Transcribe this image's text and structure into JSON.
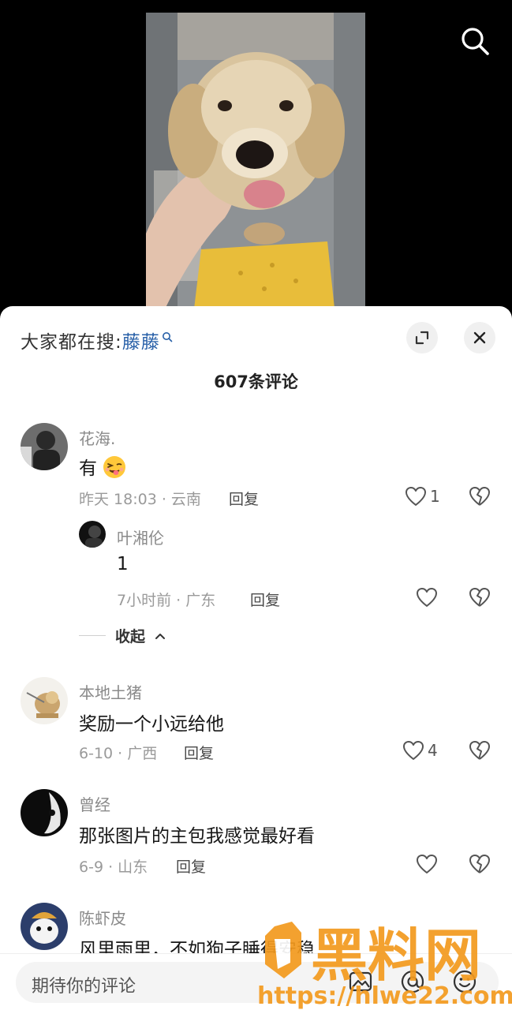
{
  "panel": {
    "hot_search_prefix": "大家都在搜:",
    "hot_search_keyword": "藤藤",
    "comment_count": "607条评论"
  },
  "comments": [
    {
      "username": "花海.",
      "text": "有",
      "emoji": "wink-tongue-emoji",
      "time_location": "昨天 18:03 · 云南",
      "reply_label": "回复",
      "likes": "1",
      "replies": [
        {
          "username": "叶湘伦",
          "text": "1",
          "time_location": "7小时前 · 广东",
          "reply_label": "回复",
          "likes": ""
        }
      ],
      "collapse_label": "收起"
    },
    {
      "username": "本地土猪",
      "text": "奖励一个小远给他",
      "time_location": "6-10 · 广西",
      "reply_label": "回复",
      "likes": "4"
    },
    {
      "username": "曾经",
      "text": "那张图片的主包我感觉最好看",
      "time_location": "6-9 · 山东",
      "reply_label": "回复",
      "likes": ""
    },
    {
      "username": "陈虾皮",
      "text": "风里雨里，不如狗子睡得安稳"
    }
  ],
  "bottom_bar": {
    "placeholder": "期待你的评论",
    "icons": [
      "image-icon",
      "at-icon",
      "emoji-icon"
    ]
  },
  "watermark": {
    "title": "黑料网",
    "url": "https://hlwe22.com"
  },
  "icons": {
    "top_right": "search-icon",
    "panel_buttons": [
      "expand-icon",
      "close-icon"
    ]
  },
  "colors": {
    "keyword": "#2860a8",
    "watermark_orange": "#f39a1e"
  }
}
